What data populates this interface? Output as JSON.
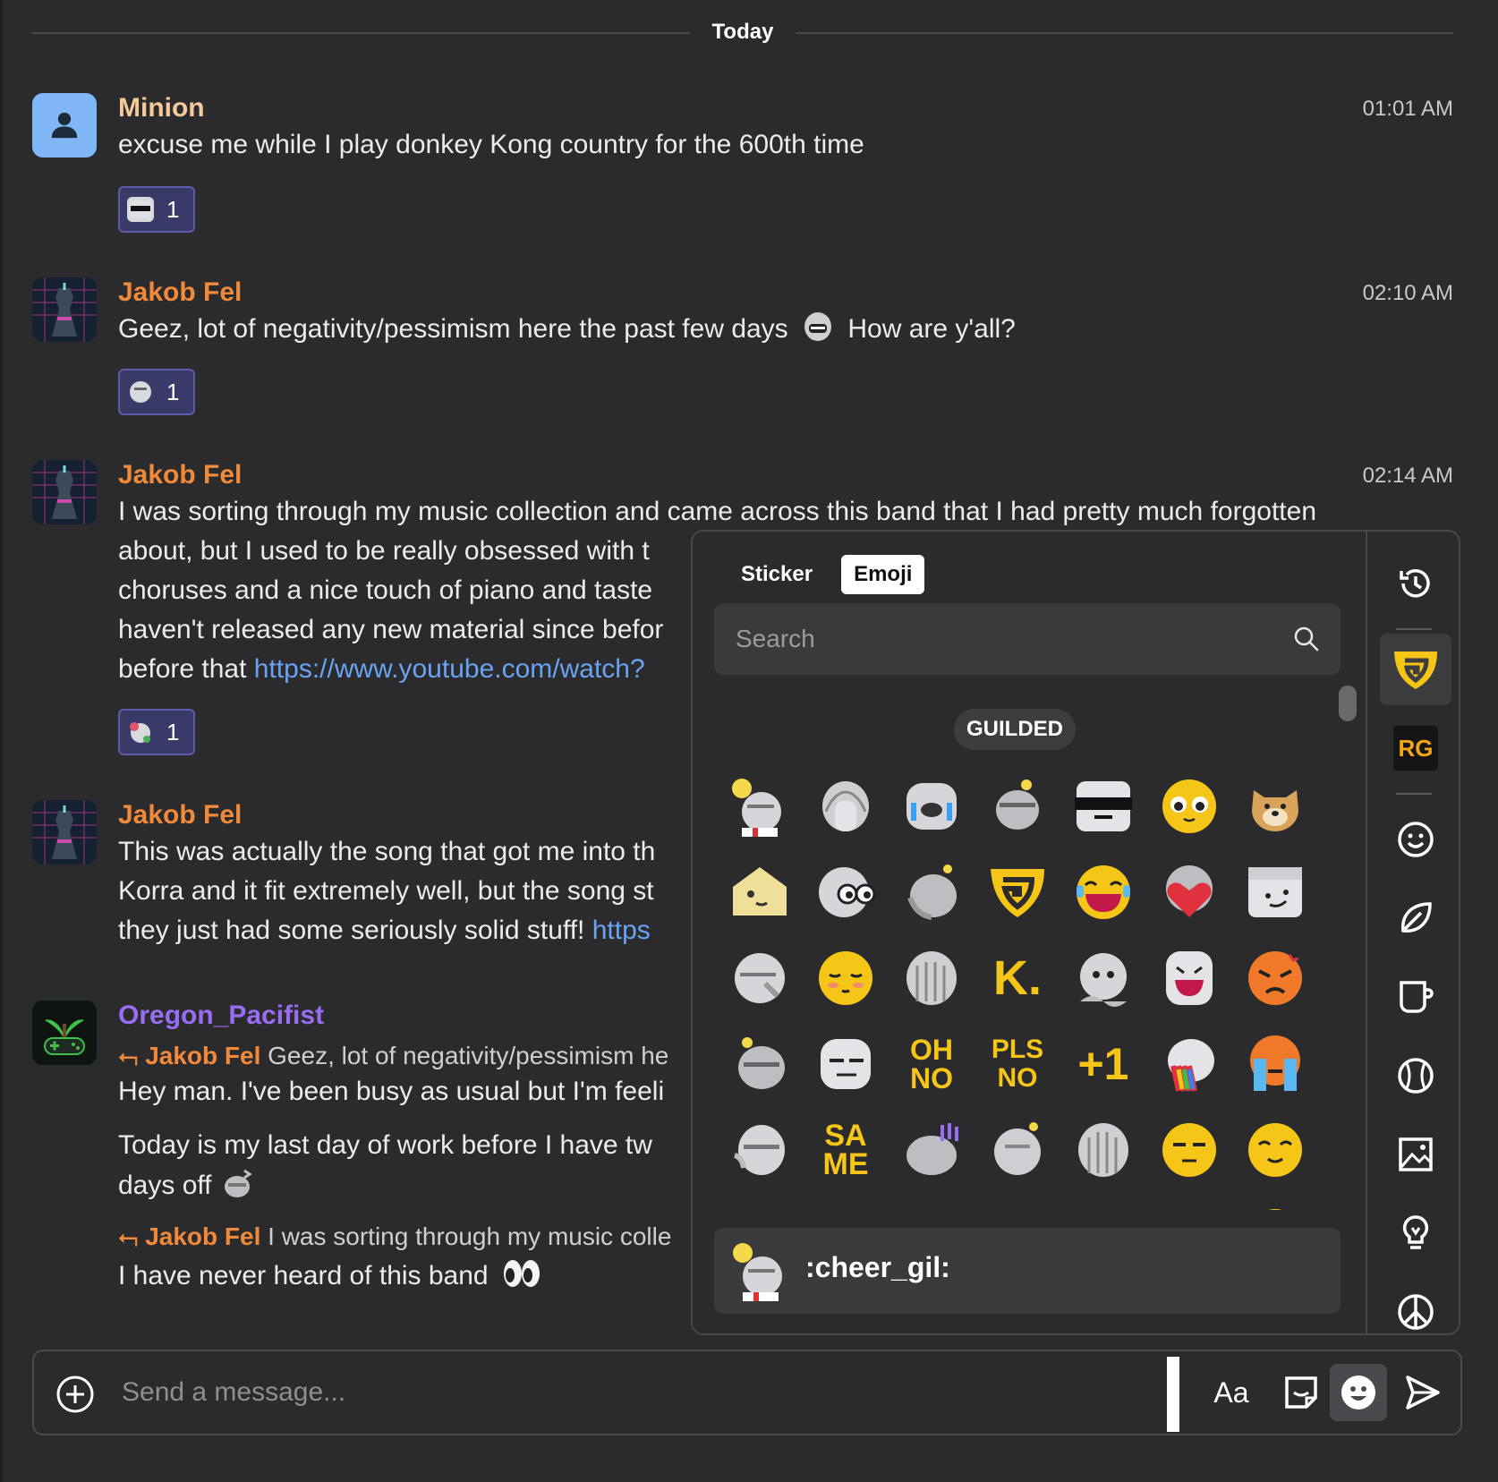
{
  "divider": {
    "label": "Today"
  },
  "messages": [
    {
      "author": "Minion",
      "author_color": "#f6c99a",
      "time": "01:01 AM",
      "text": "excuse me while I play donkey Kong country for the 600th time",
      "reaction_count": "1"
    },
    {
      "author": "Jakob Fel",
      "author_color": "#f08a3a",
      "time": "02:10 AM",
      "text_before": "Geez, lot of negativity/pessimism here the past few days",
      "text_after": "How are y'all?",
      "reaction_count": "1"
    },
    {
      "author": "Jakob Fel",
      "author_color": "#f08a3a",
      "time": "02:14 AM",
      "lines": [
        "I was sorting through my music collection and came across this band that I had pretty much forgotten",
        "about, but I used to be really obsessed with t",
        "choruses and a nice touch of piano and taste",
        "haven't released any new material since befor"
      ],
      "line5_prefix": "before that",
      "link": "https://www.youtube.com/watch?",
      "reaction_count": "1"
    },
    {
      "author": "Jakob Fel",
      "author_color": "#f08a3a",
      "lines": [
        "This was actually the song that got me into th",
        "Korra and it fit extremely well, but the song st"
      ],
      "line3_prefix": "they just had some seriously solid stuff!",
      "link": "https"
    },
    {
      "author": "Oregon_Pacifist",
      "author_color": "#9a6cf2",
      "reply1_author": "Jakob Fel",
      "reply1_text": "Geez, lot of negativity/pessimism he",
      "text1": "Hey man. I've been busy as usual but I'm feeli",
      "text2_line1": "Today is my last day of work before I have tw",
      "text2_line2": "days off",
      "reply2_author": "Jakob Fel",
      "reply2_text": "I was sorting through my music colle",
      "text3": "I have never heard of this band"
    }
  ],
  "picker": {
    "tabs": [
      "Sticker",
      "Emoji"
    ],
    "active_tab": "Emoji",
    "search_placeholder": "Search",
    "section": "GUILDED",
    "text_emoji": {
      "k": "K.",
      "ohno_1": "OH",
      "ohno_2": "NO",
      "plsno_1": "PLS",
      "plsno_2": "NO",
      "plus1": "+1",
      "same_1": "SA",
      "same_2": "ME"
    },
    "sidebar_rg": "RG",
    "preview_name": ":cheer_gil:",
    "accent": "#f5c518"
  },
  "composer": {
    "placeholder": "Send a message...",
    "font_button": "Aa"
  }
}
